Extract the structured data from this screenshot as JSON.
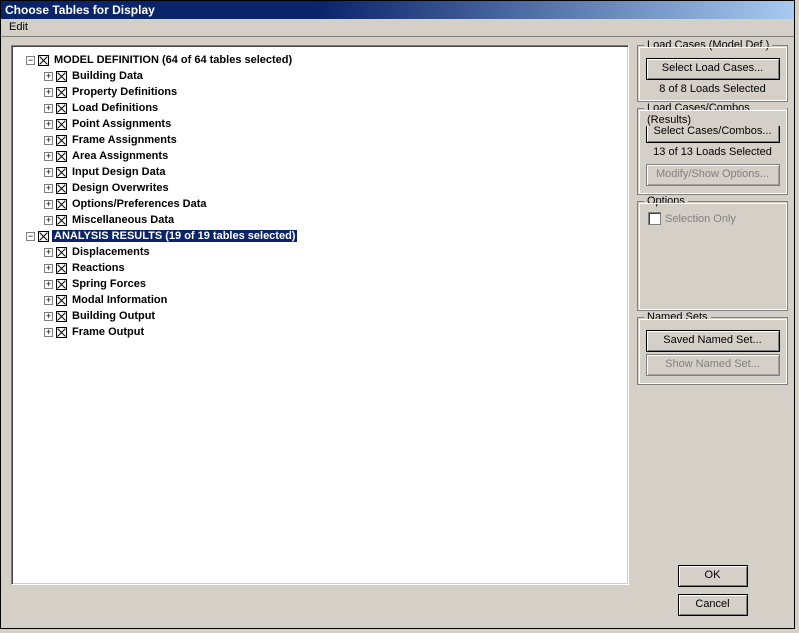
{
  "title": "Choose Tables for Display",
  "menu": {
    "edit": "Edit"
  },
  "tree": {
    "root1": {
      "label": "MODEL DEFINITION  (64 of 64 tables selected)",
      "expand": "−"
    },
    "r1c": [
      "Building Data",
      "Property Definitions",
      "Load Definitions",
      "Point Assignments",
      "Frame Assignments",
      "Area Assignments",
      "Input Design Data",
      "Design Overwrites",
      "Options/Preferences Data",
      "Miscellaneous Data"
    ],
    "root2": {
      "label": "ANALYSIS RESULTS  (19 of 19 tables selected)",
      "expand": "−"
    },
    "r2c": [
      "Displacements",
      "Reactions",
      "Spring Forces",
      "Modal Information",
      "Building Output",
      "Frame Output"
    ]
  },
  "side": {
    "g1": {
      "title": "Load Cases (Model Def.)",
      "btn": "Select Load Cases...",
      "status": "8 of  8 Loads Selected"
    },
    "g2": {
      "title": "Load Cases/Combos (Results)",
      "btn1": "Select Cases/Combos...",
      "status": "13 of  13 Loads Selected",
      "btn2": "Modify/Show Options..."
    },
    "g3": {
      "title": "Options",
      "chk": "Selection Only"
    },
    "g4": {
      "title": "Named Sets",
      "btn1": "Saved Named Set...",
      "btn2": "Show Named Set..."
    }
  },
  "buttons": {
    "ok": "OK",
    "cancel": "Cancel"
  }
}
